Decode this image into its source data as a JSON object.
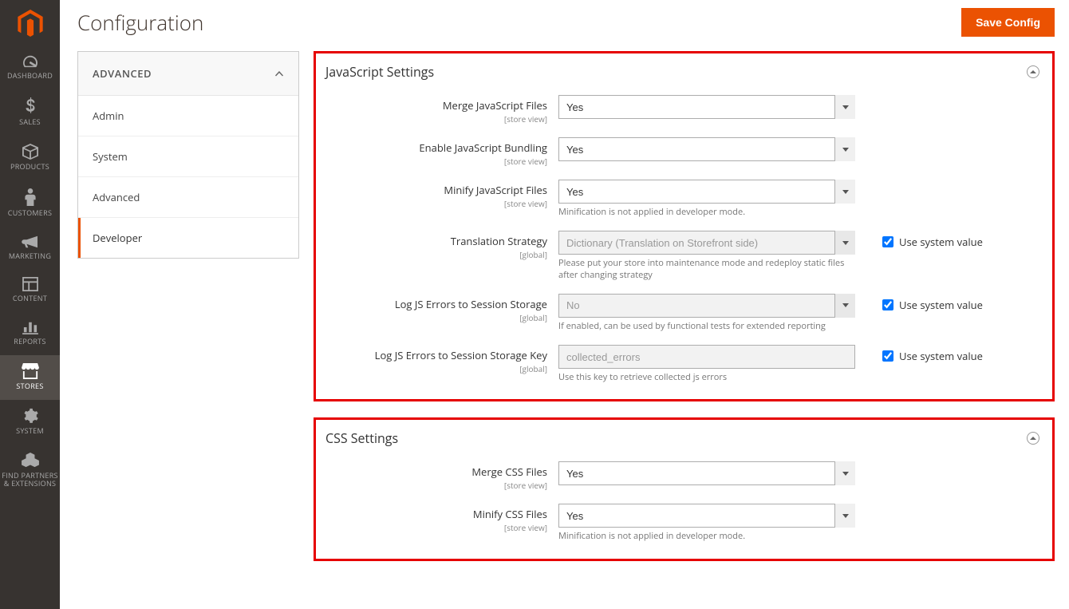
{
  "header": {
    "title": "Configuration",
    "save_label": "Save Config"
  },
  "sidenav": {
    "items": [
      {
        "label": "DASHBOARD"
      },
      {
        "label": "SALES"
      },
      {
        "label": "PRODUCTS"
      },
      {
        "label": "CUSTOMERS"
      },
      {
        "label": "MARKETING"
      },
      {
        "label": "CONTENT"
      },
      {
        "label": "REPORTS"
      },
      {
        "label": "STORES"
      },
      {
        "label": "SYSTEM"
      },
      {
        "label": "FIND PARTNERS\n& EXTENSIONS"
      }
    ]
  },
  "config_tabs": {
    "group_label": "ADVANCED",
    "items": [
      {
        "label": "Admin"
      },
      {
        "label": "System"
      },
      {
        "label": "Advanced"
      },
      {
        "label": "Developer"
      }
    ]
  },
  "js_panel": {
    "title": "JavaScript Settings",
    "merge_label": "Merge JavaScript Files",
    "merge_scope": "[store view]",
    "merge_value": "Yes",
    "bundle_label": "Enable JavaScript Bundling",
    "bundle_scope": "[store view]",
    "bundle_value": "Yes",
    "minify_label": "Minify JavaScript Files",
    "minify_scope": "[store view]",
    "minify_value": "Yes",
    "minify_note": "Minification is not applied in developer mode.",
    "translation_label": "Translation Strategy",
    "translation_scope": "[global]",
    "translation_value": "Dictionary (Translation on Storefront side)",
    "translation_note": "Please put your store into maintenance mode and redeploy static files after changing strategy",
    "log_errors_label": "Log JS Errors to Session Storage",
    "log_errors_scope": "[global]",
    "log_errors_value": "No",
    "log_errors_note": "If enabled, can be used by functional tests for extended reporting",
    "log_key_label": "Log JS Errors to Session Storage Key",
    "log_key_scope": "[global]",
    "log_key_value": "collected_errors",
    "log_key_note": "Use this key to retrieve collected js errors",
    "use_system_label": "Use system value"
  },
  "css_panel": {
    "title": "CSS Settings",
    "merge_label": "Merge CSS Files",
    "merge_scope": "[store view]",
    "merge_value": "Yes",
    "minify_label": "Minify CSS Files",
    "minify_scope": "[store view]",
    "minify_value": "Yes",
    "minify_note": "Minification is not applied in developer mode."
  }
}
